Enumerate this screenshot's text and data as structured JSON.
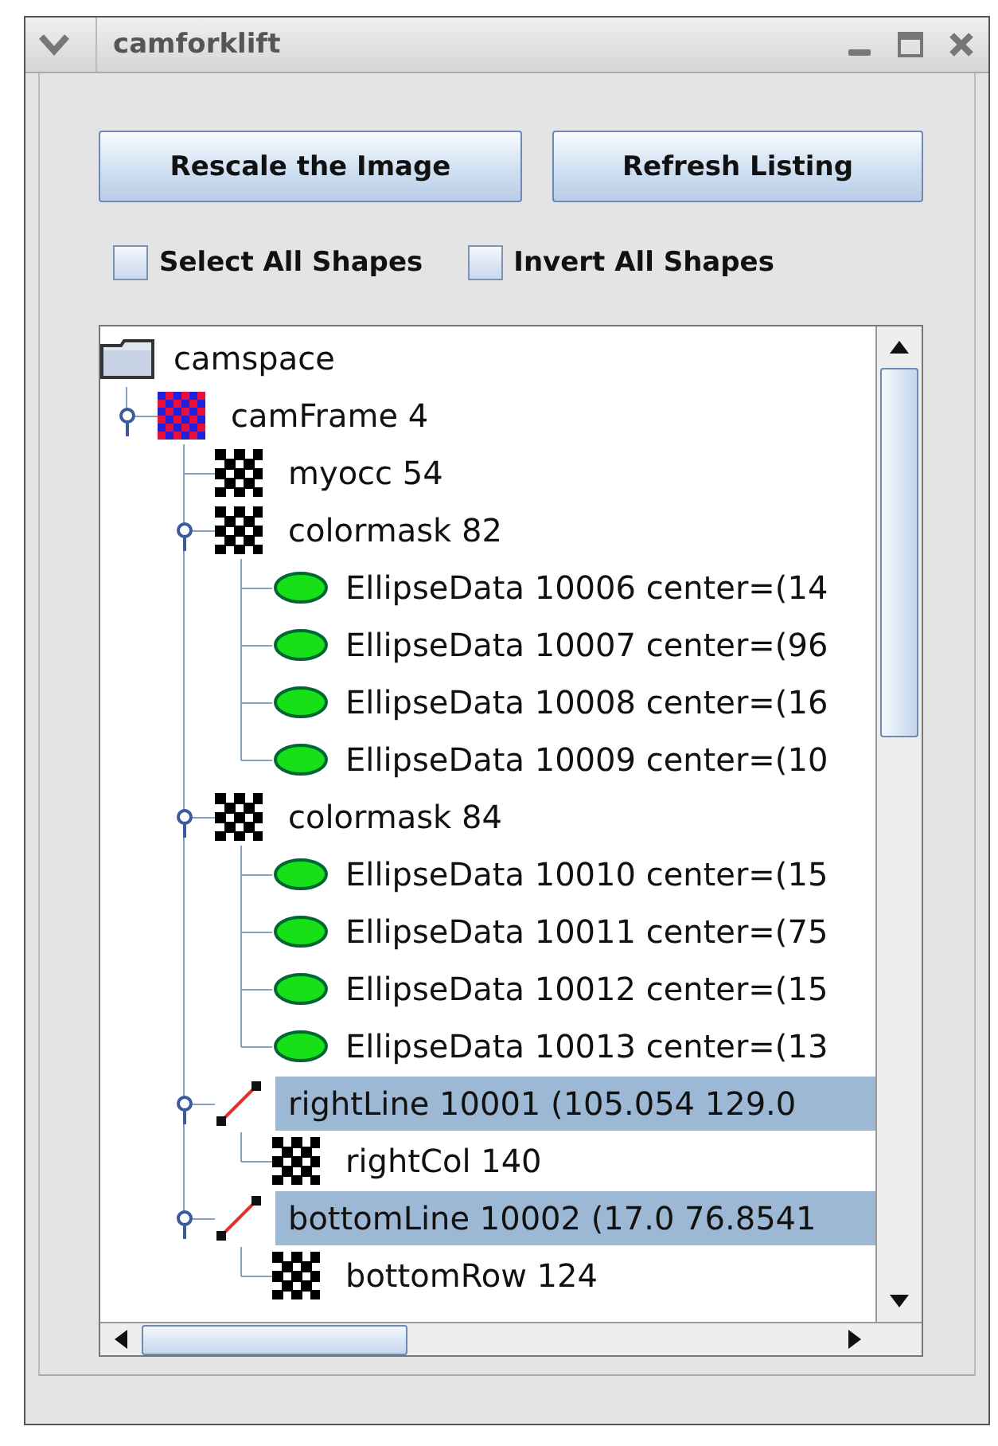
{
  "window": {
    "title": "camforklift"
  },
  "buttons": [
    {
      "label": "Rescale the Image"
    },
    {
      "label": "Refresh Listing"
    }
  ],
  "checkboxes": [
    {
      "label": "Select All Shapes",
      "checked": false
    },
    {
      "label": "Invert All Shapes",
      "checked": false
    }
  ],
  "tree": {
    "root": {
      "label": "camspace",
      "kind": "folder",
      "selected": false,
      "children": [
        {
          "label": "camFrame 4",
          "kind": "frame",
          "expanded": true,
          "selected": false,
          "children": [
            {
              "label": "myocc 54",
              "kind": "mask",
              "selected": false
            },
            {
              "label": "colormask 82",
              "kind": "mask",
              "expanded": true,
              "selected": false,
              "children": [
                {
                  "label": "EllipseData 10006 center=(14",
                  "kind": "ellipse",
                  "selected": false
                },
                {
                  "label": "EllipseData 10007 center=(96",
                  "kind": "ellipse",
                  "selected": false
                },
                {
                  "label": "EllipseData 10008 center=(16",
                  "kind": "ellipse",
                  "selected": false
                },
                {
                  "label": "EllipseData 10009 center=(10",
                  "kind": "ellipse",
                  "selected": false
                }
              ]
            },
            {
              "label": "colormask 84",
              "kind": "mask",
              "expanded": true,
              "selected": false,
              "children": [
                {
                  "label": "EllipseData 10010 center=(15",
                  "kind": "ellipse",
                  "selected": false
                },
                {
                  "label": "EllipseData 10011 center=(75",
                  "kind": "ellipse",
                  "selected": false
                },
                {
                  "label": "EllipseData 10012 center=(15",
                  "kind": "ellipse",
                  "selected": false
                },
                {
                  "label": "EllipseData 10013 center=(13",
                  "kind": "ellipse",
                  "selected": false
                }
              ]
            },
            {
              "label": "rightLine 10001 (105.054 129.0",
              "kind": "line",
              "expanded": true,
              "selected": true,
              "children": [
                {
                  "label": "rightCol 140",
                  "kind": "mask",
                  "selected": false
                }
              ]
            },
            {
              "label": "bottomLine 10002 (17.0 76.8541",
              "kind": "line",
              "expanded": true,
              "selected": true,
              "children": [
                {
                  "label": "bottomRow 124",
                  "kind": "mask",
                  "selected": false
                }
              ]
            }
          ]
        }
      ]
    }
  }
}
